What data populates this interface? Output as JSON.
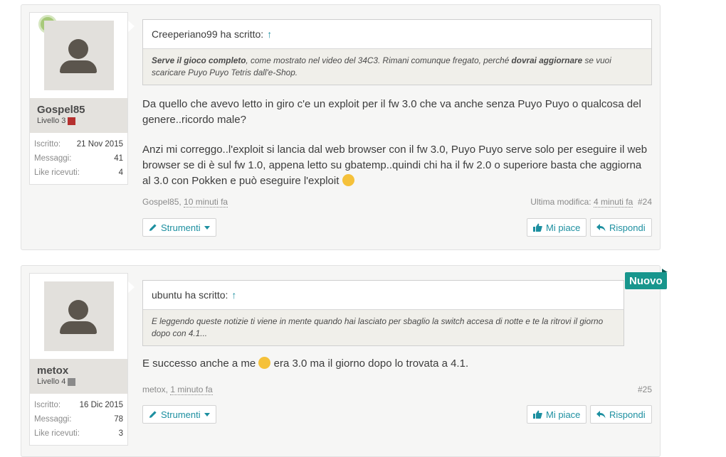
{
  "posts": [
    {
      "user": {
        "name": "Gospel85",
        "level": "Livello 3",
        "online": true,
        "stats": [
          {
            "label": "Iscritto:",
            "value": "21 Nov 2015"
          },
          {
            "label": "Messaggi:",
            "value": "41"
          },
          {
            "label": "Like ricevuti:",
            "value": "4"
          }
        ]
      },
      "quote": {
        "header": "Creeperiano99 ha scritto:",
        "arrow": "↑",
        "b1": "Serve il gioco completo",
        "t1": ", come mostrato nel video del 34C3. Rimani comunque fregato, perché ",
        "b2": "dovrai aggiornare",
        "t2": " se vuoi scaricare Puyo Puyo Tetris dall'e-Shop."
      },
      "paragraphs": [
        "Da quello che avevo letto in giro c'e un exploit per il fw 3.0 che va anche senza Puyo Puyo o qualcosa del genere..ricordo male?",
        "Anzi mi correggo..l'exploit si lancia dal web browser con il fw 3.0, Puyo Puyo serve solo per eseguire il web browser se di è sul fw 1.0, appena letto su gbatemp..quindi chi ha il fw 2.0 o superiore basta che aggiorna al 3.0 con Pokken e può eseguire l'exploit"
      ],
      "meta": {
        "author": "Gospel85,",
        "time": "10 minuti fa",
        "edited_label": "Ultima modifica:",
        "edited_time": "4 minuti fa",
        "number": "#24"
      },
      "buttons": {
        "tools": "Strumenti",
        "like": "Mi piace",
        "reply": "Rispondi"
      }
    },
    {
      "user": {
        "name": "metox",
        "level": "Livello 4",
        "online": false,
        "stats": [
          {
            "label": "Iscritto:",
            "value": "16 Dic 2015"
          },
          {
            "label": "Messaggi:",
            "value": "78"
          },
          {
            "label": "Like ricevuti:",
            "value": "3"
          }
        ]
      },
      "quote": {
        "header": "ubuntu ha scritto:",
        "arrow": "↑",
        "text": "E leggendo queste notizie ti viene in mente quando hai lasciato per sbaglio la switch accesa di notte e te la ritrovi il giorno dopo con 4.1..."
      },
      "paragraphs": [
        "E successo anche a me",
        "era 3.0 ma il giorno dopo lo trovata a 4.1."
      ],
      "meta": {
        "author": "metox,",
        "time": "1 minuto fa",
        "number": "#25"
      },
      "buttons": {
        "tools": "Strumenti",
        "like": "Mi piace",
        "reply": "Rispondi"
      },
      "badge": "Nuovo"
    }
  ],
  "colors": {
    "accent": "#1c8fa0",
    "badge": "#18968d"
  }
}
